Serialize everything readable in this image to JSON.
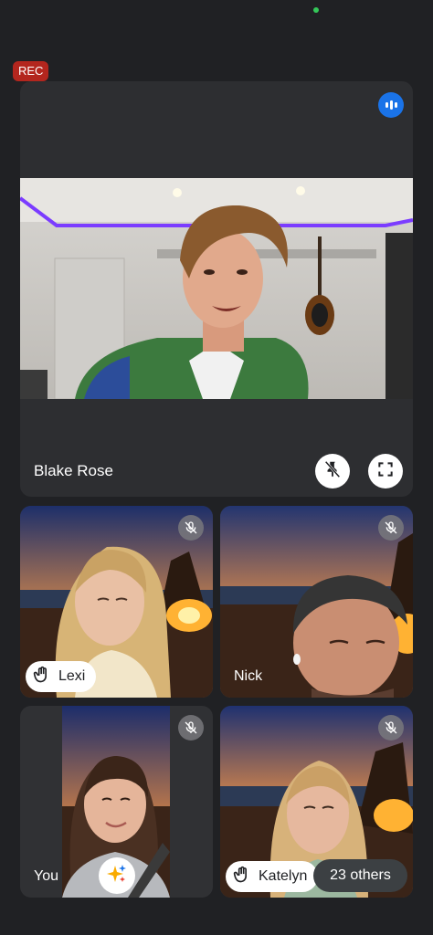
{
  "rec_label": "REC",
  "main": {
    "name": "Blake Rose"
  },
  "participants": {
    "lexi": "Lexi",
    "nick": "Nick",
    "you": "You",
    "katelyn": "Katelyn"
  },
  "others_label": "23 others",
  "colors": {
    "accent": "#1a73e8",
    "rec": "#b3261e",
    "background": "#202124"
  },
  "icons": {
    "speaking": "audio-level-icon",
    "pin": "unpin-icon",
    "fullscreen": "fullscreen-icon",
    "mute": "mic-off-icon",
    "hand": "raised-hand-icon",
    "effects": "sparkle-icon"
  }
}
